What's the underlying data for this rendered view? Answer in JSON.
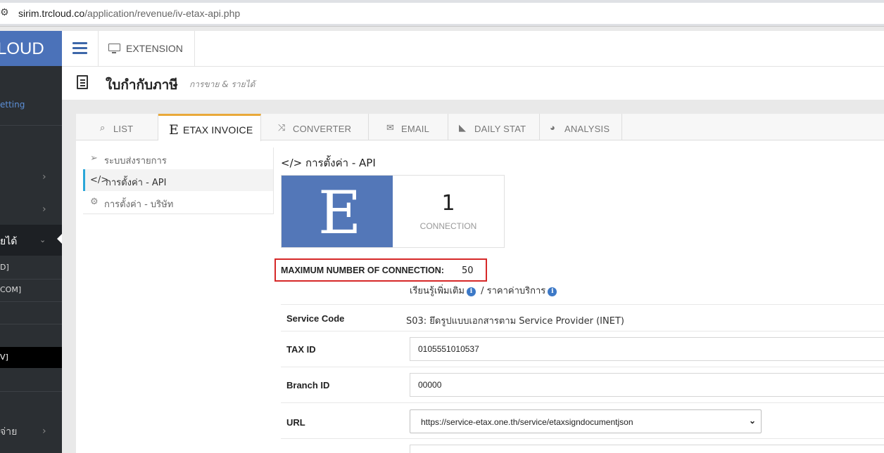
{
  "browser": {
    "url_host": "sirim.trcloud.co",
    "url_path": "/application/revenue/iv-etax-api.php"
  },
  "sidebar": {
    "brand": "LOUD",
    "setting_link": "etting",
    "active_item": "ยได้",
    "sub_items": [
      "D]",
      "COM]"
    ],
    "black_item": "V]",
    "last_item": "จ่าย"
  },
  "topnav": {
    "extension_label": "EXTENSION"
  },
  "page_header": {
    "title": "ใบกำกับภาษี",
    "subtitle": "การขาย & รายได้"
  },
  "tabs": [
    {
      "icon": "search-icon",
      "label": "LIST"
    },
    {
      "icon": "etax-e-icon",
      "label": "ETAX INVOICE",
      "active": true
    },
    {
      "icon": "shuffle-icon",
      "label": "CONVERTER"
    },
    {
      "icon": "envelope-icon",
      "label": "EMAIL"
    },
    {
      "icon": "area-chart-icon",
      "label": "DAILY STAT"
    },
    {
      "icon": "pie-chart-icon",
      "label": "ANALYSIS"
    }
  ],
  "subnav": [
    {
      "icon": "paper-plane-icon",
      "label": "ระบบส่งรายการ"
    },
    {
      "icon": "code-icon",
      "label": "การตั้งค่า - API",
      "active": true
    },
    {
      "icon": "gear-icon",
      "label": "การตั้งค่า - บริษัท"
    }
  ],
  "main": {
    "title": "การตั้งค่า - API",
    "tile_letter": "E",
    "connection_count": "1",
    "connection_caption": "CONNECTION",
    "max_connection_label": "MAXIMUM NUMBER OF CONNECTION:",
    "max_connection_value": "50",
    "learn_more": "เรียนรู้เพิ่มเติม",
    "separator": "/",
    "pricing": "ราคาค่าบริการ",
    "fields": {
      "service_code_label": "Service Code",
      "service_code_value": "S03: ยึดรูปแบบเอกสารตาม Service Provider (INET)",
      "tax_id_label": "TAX ID",
      "tax_id_value": "0105551010537",
      "branch_id_label": "Branch ID",
      "branch_id_value": "00000",
      "url_label": "URL",
      "url_value": "https://service-etax.one.th/service/etaxsigndocumentjson"
    }
  }
}
